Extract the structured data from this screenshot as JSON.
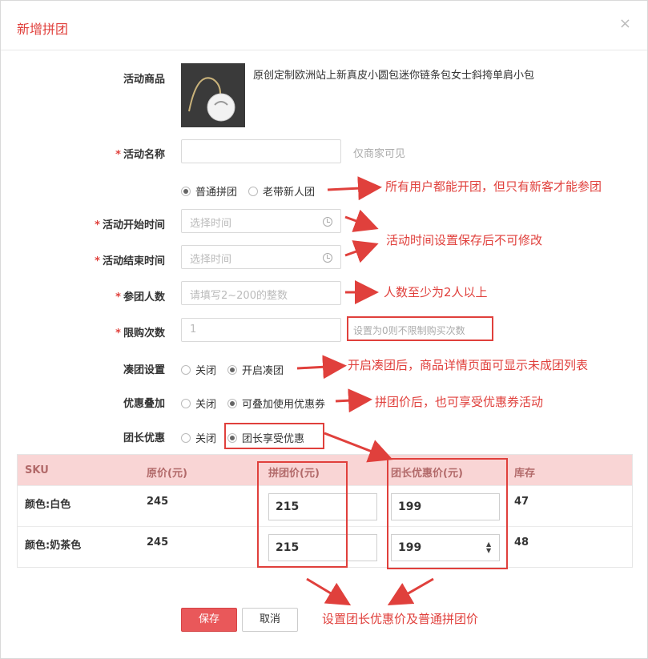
{
  "dialog": {
    "title": "新增拼团",
    "close_glyph": "×"
  },
  "product": {
    "label": "活动商品",
    "name": "原创定制欧洲站上新真皮小圆包迷你链条包女士斜挎单肩小包"
  },
  "fields": {
    "activity_name": {
      "label": "活动名称",
      "value": "",
      "hint": "仅商家可见"
    },
    "group_type": {
      "options": [
        "普通拼团",
        "老带新人团"
      ],
      "selected": "普通拼团"
    },
    "start_time": {
      "label": "活动开始时间",
      "placeholder": "选择时间"
    },
    "end_time": {
      "label": "活动结束时间",
      "placeholder": "选择时间"
    },
    "group_size": {
      "label": "参团人数",
      "placeholder": "请填写2~200的整数"
    },
    "purchase_limit": {
      "label": "限购次数",
      "value": "1",
      "hint": "设置为0则不限制购买次数"
    },
    "auto_group": {
      "label": "凑团设置",
      "options": [
        "关闭",
        "开启凑团"
      ],
      "selected": "开启凑团"
    },
    "discount_stack": {
      "label": "优惠叠加",
      "options": [
        "关闭",
        "可叠加使用优惠券"
      ],
      "selected": "可叠加使用优惠券"
    },
    "leader_discount": {
      "label": "团长优惠",
      "options": [
        "关闭",
        "团长享受优惠"
      ],
      "selected": "团长享受优惠"
    },
    "required_mark": "*"
  },
  "sku_table": {
    "headers": [
      "SKU",
      "原价(元)",
      "拼团价(元)",
      "团长优惠价(元)",
      "库存"
    ],
    "rows": [
      {
        "sku": "颜色:白色",
        "price": "245",
        "group_price": "215",
        "leader_price": "199",
        "stock": "47"
      },
      {
        "sku": "颜色:奶茶色",
        "price": "245",
        "group_price": "215",
        "leader_price": "199",
        "stock": "48"
      }
    ]
  },
  "buttons": {
    "save": "保存",
    "cancel": "取消"
  },
  "annotations": {
    "a1": "所有用户都能开团，但只有新客才能参团",
    "a2": "活动时间设置保存后不可修改",
    "a3": "人数至少为2人以上",
    "a4": "开启凑团后，商品详情页面可显示未成团列表",
    "a5": "拼团价后，也可享受优惠券活动",
    "a6": "设置团长优惠价及普通拼团价"
  },
  "colors": {
    "accent": "#e0403c",
    "header_bg": "#f9d5d5",
    "primary_button": "#e9585a"
  },
  "icons": {
    "clock": "clock-icon",
    "close": "close-icon",
    "stepper": "spinner-arrows-icon"
  }
}
